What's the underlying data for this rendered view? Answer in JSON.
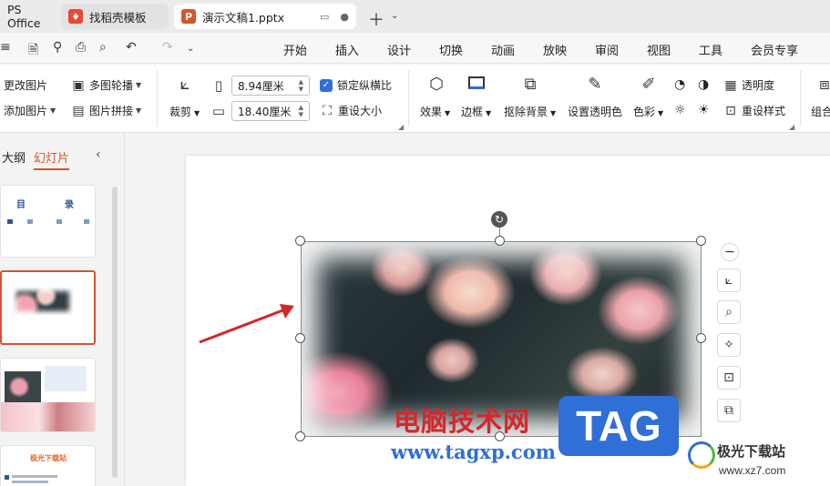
{
  "tabs": [
    {
      "label": "PS Office",
      "icon": "wps-icon"
    },
    {
      "label": "找稻壳模板",
      "icon": "docer-icon"
    },
    {
      "label": "演示文稿1.pptx",
      "icon": "presentation-icon",
      "active": true
    }
  ],
  "menu": [
    "开始",
    "插入",
    "设计",
    "切换",
    "动画",
    "放映",
    "审阅",
    "视图",
    "工具",
    "会员专享"
  ],
  "ribbon": {
    "change_image": "更改图片",
    "add_image": "添加图片",
    "multi_carousel": "多图轮播",
    "image_collage": "图片拼接",
    "crop": "裁剪",
    "height_value": "8.94厘米",
    "width_value": "18.40厘米",
    "lock_ratio": "锁定纵横比",
    "reset_size": "重设大小",
    "effects": "效果",
    "border": "边框",
    "remove_bg": "抠除背景",
    "set_transparent_color": "设置透明色",
    "color": "色彩",
    "transparency": "透明度",
    "reset_style": "重设样式",
    "combine": "组合"
  },
  "left_pane": {
    "tab_outline": "大纲",
    "tab_slides": "幻灯片",
    "slide1_title": "目",
    "slide1_title2": "录",
    "slide4_title": "极光下载站"
  },
  "watermark": {
    "cn_text": "电脑技术网",
    "url": "www.tagxp.com",
    "tag": "TAG",
    "site_cn": "极光下载站",
    "site_url": "www.xz7.com"
  },
  "colors": {
    "accent": "#d4562b",
    "blue": "#2f6fd6",
    "watermark_red": "#d8262b"
  }
}
